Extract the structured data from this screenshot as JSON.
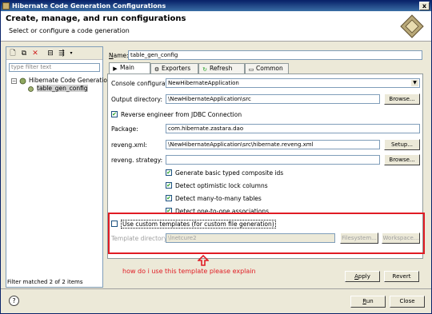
{
  "window": {
    "title": "Hibernate Code Generation Configurations",
    "close": "x"
  },
  "banner": {
    "title": "Create, manage, and run configurations",
    "subtitle": "Select or configure a code generation"
  },
  "left": {
    "filter_placeholder": "type filter text",
    "tree": [
      {
        "label": "Hibernate Code Generation",
        "expanded": true
      },
      {
        "label": "table_gen_config",
        "selected": true
      }
    ],
    "status": "Filter matched 2 of 2 items"
  },
  "config": {
    "name_label": "Name:",
    "name_value": "table_gen_config",
    "tabs": [
      {
        "label": "Main",
        "icon": "main-icon",
        "active": true
      },
      {
        "label": "Exporters",
        "icon": "exporters-icon"
      },
      {
        "label": "Refresh",
        "icon": "refresh-icon"
      },
      {
        "label": "Common",
        "icon": "common-icon"
      }
    ],
    "console_label": "Console configuration:",
    "console_value": "NewHibernateApplication",
    "output_label": "Output directory:",
    "output_value": "\\NewHibernateApplication\\src",
    "browse1": "Browse...",
    "reverse_label": "Reverse engineer from JDBC Connection",
    "reverse_checked": true,
    "package_label": "Package:",
    "package_value": "com.hibernate.zastara.dao",
    "reveng_label": "reveng.xml:",
    "reveng_value": "\\NewHibernateApplication\\src\\hibernate.reveng.xml",
    "setup": "Setup...",
    "strategy_label": "reveng. strategy:",
    "strategy_value": "",
    "browse2": "Browse...",
    "options": [
      {
        "label": "Generate basic typed composite ids",
        "checked": true
      },
      {
        "label": "Detect optimistic lock columns",
        "checked": true
      },
      {
        "label": "Detect many-to-many tables",
        "checked": true
      },
      {
        "label": "Detect one-to-one associations",
        "checked": true
      }
    ],
    "custom_templates_label": "Use custom templates (for custom file generation)",
    "custom_templates_checked": false,
    "template_dir_label": "Template directory:",
    "template_dir_value": "\\lnetcure2",
    "filesystem": "Filesystem...",
    "workspace": "Workspace...",
    "apply": "Apply",
    "revert": "Revert"
  },
  "annotation": "how do i use this template please explain",
  "footer": {
    "help": "?",
    "run": "Run",
    "close": "Close"
  },
  "colors": {
    "accent_red": "#e01c24",
    "title_blue": "#0a246a"
  }
}
